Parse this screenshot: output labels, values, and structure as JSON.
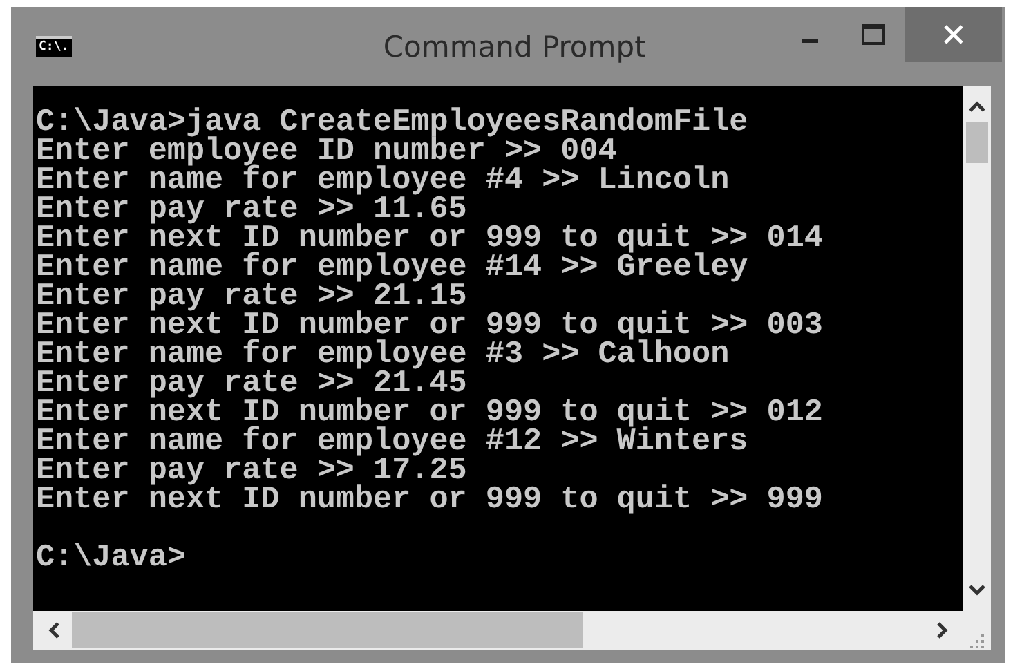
{
  "window": {
    "title": "Command Prompt",
    "icon_text": "C:\\."
  },
  "console": {
    "blocks": [
      {
        "lines": [
          "C:\\Java>java CreateEmployeesRandomFile",
          "Enter employee ID number >> 004",
          "Enter name for employee #4 >> Lincoln",
          "Enter pay rate >> 11.65",
          "Enter next ID number or 999 to quit >> 014",
          "Enter name for employee #14 >> Greeley",
          "Enter pay rate >> 21.15",
          "Enter next ID number or 999 to quit >> 003",
          "Enter name for employee #3 >> Calhoon",
          "Enter pay rate >> 21.45",
          "Enter next ID number or 999 to quit >> 012",
          "Enter name for employee #12 >> Winters",
          "Enter pay rate >> 17.25",
          "Enter next ID number or 999 to quit >> 999"
        ]
      },
      {
        "lines": [
          "C:\\Java>"
        ]
      }
    ]
  }
}
